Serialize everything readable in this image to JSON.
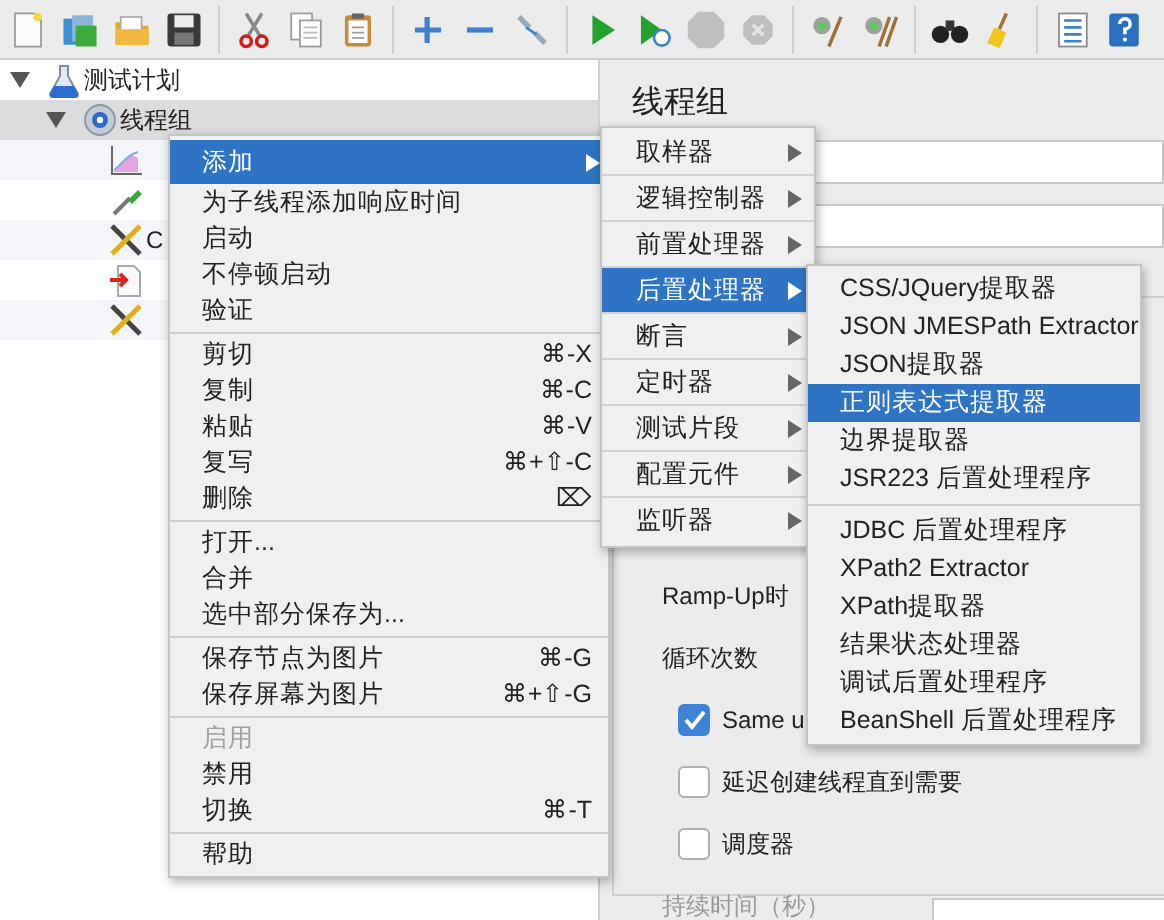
{
  "toolbar": [
    [
      {
        "kind": "new"
      },
      {
        "kind": "templates"
      },
      {
        "kind": "open"
      },
      {
        "kind": "save"
      }
    ],
    [
      {
        "kind": "cut"
      },
      {
        "kind": "copy"
      },
      {
        "kind": "paste"
      }
    ],
    [
      {
        "kind": "add"
      },
      {
        "kind": "remove"
      },
      {
        "kind": "toggle"
      }
    ],
    [
      {
        "kind": "start"
      },
      {
        "kind": "start_no_pause"
      },
      {
        "kind": "stop",
        "disabled": true
      },
      {
        "kind": "shutdown",
        "disabled": true
      }
    ],
    [
      {
        "kind": "clear"
      },
      {
        "kind": "clear_all"
      }
    ],
    [
      {
        "kind": "search"
      },
      {
        "kind": "reset"
      }
    ],
    [
      {
        "kind": "functions"
      },
      {
        "kind": "help"
      }
    ]
  ],
  "tree": [
    {
      "label": "测试计划",
      "kind": "flask",
      "expanded": true,
      "selected": false,
      "children": [
        {
          "label": "线程组",
          "kind": "gear",
          "expanded": true,
          "selected": true,
          "children": [
            {
              "kind": "graph",
              "selected": false
            },
            {
              "kind": "pipette",
              "selected": false
            },
            {
              "label": "C",
              "kind": "tools",
              "selected": false
            },
            {
              "kind": "doc",
              "selected": false
            },
            {
              "kind": "tools",
              "selected": false
            }
          ]
        }
      ]
    }
  ],
  "panel": {
    "title": "线程组",
    "rows": [
      {
        "kind": "label",
        "text": "Ramp-Up时"
      },
      {
        "kind": "label",
        "text": "循环次数"
      },
      {
        "kind": "checkbox",
        "text": "Same u",
        "checked": true
      },
      {
        "kind": "checkbox",
        "text": "延迟创建线程直到需要",
        "checked": false
      },
      {
        "kind": "checkbox",
        "text": "调度器",
        "checked": false
      },
      {
        "kind": "label",
        "text": "持续时间（秒）",
        "disabled": true
      }
    ]
  },
  "context_menu": {
    "groups": [
      [
        {
          "label": "添加",
          "submenu": true,
          "selected": true
        },
        {
          "label": "为子线程添加响应时间",
          "selected": false
        },
        {
          "label": "启动",
          "selected": false
        },
        {
          "label": "不停顿启动",
          "selected": false
        },
        {
          "label": "验证",
          "selected": false
        }
      ],
      [
        {
          "label": "剪切",
          "shortcut": "⌘-X",
          "selected": false
        },
        {
          "label": "复制",
          "shortcut": "⌘-C",
          "selected": false
        },
        {
          "label": "粘贴",
          "shortcut": "⌘-V",
          "selected": false
        },
        {
          "label": "复写",
          "shortcut": "⌘+⇧-C",
          "selected": false
        },
        {
          "label": "删除",
          "shortcut": "⌦",
          "selected": false
        }
      ],
      [
        {
          "label": "打开...",
          "selected": false
        },
        {
          "label": "合并",
          "selected": false
        },
        {
          "label": "选中部分保存为...",
          "selected": false
        }
      ],
      [
        {
          "label": "保存节点为图片",
          "shortcut": "⌘-G",
          "selected": false
        },
        {
          "label": "保存屏幕为图片",
          "shortcut": "⌘+⇧-G",
          "selected": false
        }
      ],
      [
        {
          "label": "启用",
          "disabled": true,
          "selected": false
        },
        {
          "label": "禁用",
          "selected": false
        },
        {
          "label": "切换",
          "shortcut": "⌘-T",
          "selected": false
        }
      ],
      [
        {
          "label": "帮助",
          "selected": false
        }
      ]
    ]
  },
  "add_submenu": [
    {
      "label": "取样器",
      "selected": false
    },
    {
      "label": "逻辑控制器",
      "selected": false
    },
    {
      "label": "前置处理器",
      "selected": false
    },
    {
      "label": "后置处理器",
      "selected": true
    },
    {
      "label": "断言",
      "selected": false
    },
    {
      "label": "定时器",
      "selected": false
    },
    {
      "label": "测试片段",
      "selected": false
    },
    {
      "label": "配置元件",
      "selected": false
    },
    {
      "label": "监听器",
      "selected": false
    }
  ],
  "post_processor_submenu": {
    "groups": [
      [
        {
          "label": "CSS/JQuery提取器",
          "selected": false
        },
        {
          "label": "JSON JMESPath Extractor",
          "selected": false
        },
        {
          "label": "JSON提取器",
          "selected": false
        },
        {
          "label": "正则表达式提取器",
          "selected": true
        },
        {
          "label": "边界提取器",
          "selected": false
        },
        {
          "label": "JSR223 后置处理程序",
          "selected": false
        }
      ],
      [
        {
          "label": "JDBC 后置处理程序",
          "selected": false
        },
        {
          "label": "XPath2 Extractor",
          "selected": false
        },
        {
          "label": "XPath提取器",
          "selected": false
        },
        {
          "label": "结果状态处理器",
          "selected": false
        },
        {
          "label": "调试后置处理程序",
          "selected": false
        },
        {
          "label": "BeanShell 后置处理程序",
          "selected": false
        }
      ]
    ]
  }
}
